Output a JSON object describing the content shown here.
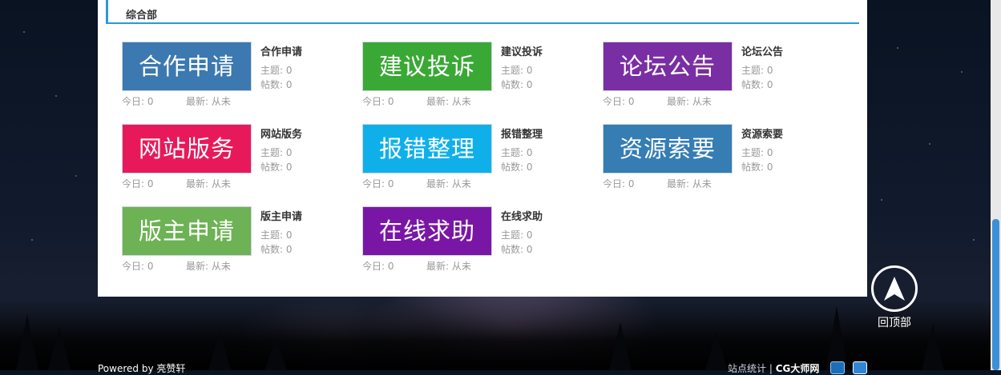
{
  "section": {
    "title": "综合部"
  },
  "forums": [
    {
      "banner": "合作申请",
      "name": "合作申请",
      "color": "#3b79b0",
      "topics_label": "主题:",
      "topics": "0",
      "posts_label": "帖数:",
      "posts": "0",
      "today_label": "今日:",
      "today": "0",
      "latest_label": "最新:",
      "latest": "从未"
    },
    {
      "banner": "建议投诉",
      "name": "建议投诉",
      "color": "#3aa835",
      "topics_label": "主题:",
      "topics": "0",
      "posts_label": "帖数:",
      "posts": "0",
      "today_label": "今日:",
      "today": "0",
      "latest_label": "最新:",
      "latest": "从未"
    },
    {
      "banner": "论坛公告",
      "name": "论坛公告",
      "color": "#7a2ea3",
      "topics_label": "主题:",
      "topics": "0",
      "posts_label": "帖数:",
      "posts": "0",
      "today_label": "今日:",
      "today": "0",
      "latest_label": "最新:",
      "latest": "从未"
    },
    {
      "banner": "网站版务",
      "name": "网站版务",
      "color": "#e8195a",
      "topics_label": "主题:",
      "topics": "0",
      "posts_label": "帖数:",
      "posts": "0",
      "today_label": "今日:",
      "today": "0",
      "latest_label": "最新:",
      "latest": "从未"
    },
    {
      "banner": "报错整理",
      "name": "报错整理",
      "color": "#0fb0ea",
      "topics_label": "主题:",
      "topics": "0",
      "posts_label": "帖数:",
      "posts": "0",
      "today_label": "今日:",
      "today": "0",
      "latest_label": "最新:",
      "latest": "从未"
    },
    {
      "banner": "资源索要",
      "name": "资源索要",
      "color": "#357db3",
      "topics_label": "主题:",
      "topics": "0",
      "posts_label": "帖数:",
      "posts": "0",
      "today_label": "今日:",
      "today": "0",
      "latest_label": "最新:",
      "latest": "从未"
    },
    {
      "banner": "版主申请",
      "name": "版主申请",
      "color": "#6db255",
      "topics_label": "主题:",
      "topics": "0",
      "posts_label": "帖数:",
      "posts": "0",
      "today_label": "今日:",
      "today": "0",
      "latest_label": "最新:",
      "latest": "从未"
    },
    {
      "banner": "在线求助",
      "name": "在线求助",
      "color": "#7a16a6",
      "topics_label": "主题:",
      "topics": "0",
      "posts_label": "帖数:",
      "posts": "0",
      "today_label": "今日:",
      "today": "0",
      "latest_label": "最新:",
      "latest": "从未"
    }
  ],
  "back_to_top": {
    "label": "回顶部",
    "icon": "arrow-up-icon"
  },
  "footer": {
    "powered_by": "Powered by",
    "powered_name": "亮赞轩",
    "stats_text": "站点统计 |",
    "site_name": "CG大师网"
  }
}
